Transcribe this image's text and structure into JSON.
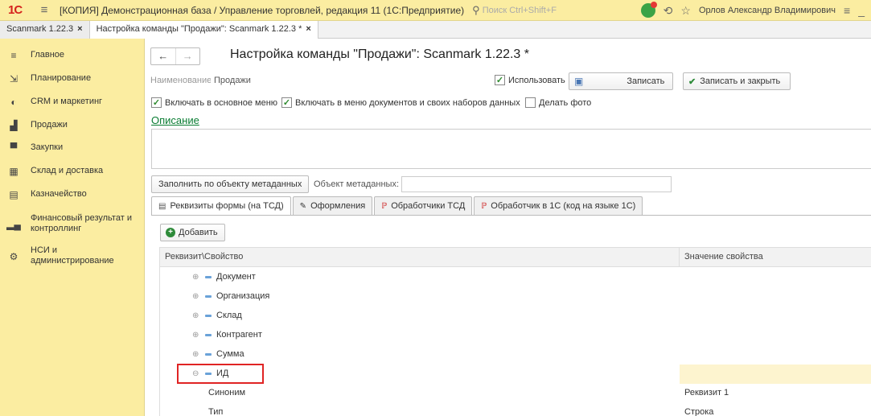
{
  "titlebar": {
    "logo": "1С",
    "title": "[КОПИЯ] Демонстрационная база / Управление торговлей, редакция 11  (1С:Предприятие)",
    "search_placeholder": "Поиск Ctrl+Shift+F",
    "user": "Орлов Александр Владимирович"
  },
  "window_tabs": [
    {
      "label": "Scanmark 1.22.3",
      "close": "×"
    },
    {
      "label": "Настройка команды \"Продажи\": Scanmark 1.22.3 *",
      "close": "×"
    }
  ],
  "sidebar": {
    "items": [
      {
        "label": "Главное",
        "icon": "menu-lines-icon"
      },
      {
        "label": "Планирование",
        "icon": "planning-icon"
      },
      {
        "label": "CRM и маркетинг",
        "icon": "crm-icon"
      },
      {
        "label": "Продажи",
        "icon": "sales-bag-icon"
      },
      {
        "label": "Закупки",
        "icon": "cart-icon"
      },
      {
        "label": "Склад и доставка",
        "icon": "warehouse-icon"
      },
      {
        "label": "Казначейство",
        "icon": "treasury-icon"
      },
      {
        "label": "Финансовый результат и контроллинг",
        "icon": "finance-chart-icon"
      },
      {
        "label": "НСИ и администрирование",
        "icon": "gear-icon"
      }
    ]
  },
  "form": {
    "title": "Настройка команды \"Продажи\": Scanmark 1.22.3 *",
    "name_label": "Наименование:",
    "name_value": "Продажи",
    "use_label": "Использовать",
    "save_label": "Записать",
    "save_close_label": "Записать и закрыть",
    "checkbox_main_menu": "Включать в основное меню",
    "checkbox_doc_menu": "Включать в меню документов и своих наборов данных",
    "checkbox_photo": "Делать фото",
    "description_link": "Описание",
    "fill_button": "Заполнить по объекту метаданных",
    "metadata_label": "Объект метаданных:"
  },
  "form_tabs": [
    {
      "label": "Реквизиты формы (на ТСД)",
      "active": true
    },
    {
      "label": "Оформления",
      "active": false
    },
    {
      "label": "Обработчики ТСД",
      "active": false
    },
    {
      "label": "Обработчик в 1С  (код на языке 1С)",
      "active": false
    }
  ],
  "add_button": "Добавить",
  "grid": {
    "columns": [
      "Реквизит\\Свойство",
      "Значение свойства"
    ],
    "rows": [
      {
        "name": "Документ",
        "value": "",
        "level": 1,
        "expanded": false
      },
      {
        "name": "Организация",
        "value": "",
        "level": 1,
        "expanded": false
      },
      {
        "name": "Склад",
        "value": "",
        "level": 1,
        "expanded": false
      },
      {
        "name": "Контрагент",
        "value": "",
        "level": 1,
        "expanded": false
      },
      {
        "name": "Сумма",
        "value": "",
        "level": 1,
        "expanded": false
      },
      {
        "name": "ИД",
        "value": "",
        "level": 1,
        "expanded": true,
        "selected": true
      },
      {
        "name": "Синоним",
        "value": "Реквизит 1",
        "level": 2
      },
      {
        "name": "Тип",
        "value": "Строка",
        "level": 2
      }
    ]
  },
  "colors": {
    "sidebar_bg": "#fbeda1",
    "accent_green": "#0a7d33",
    "highlight_red": "#e02424"
  }
}
